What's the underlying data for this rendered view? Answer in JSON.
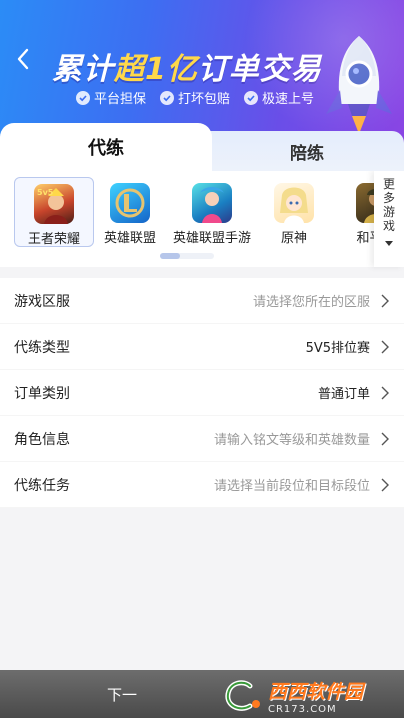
{
  "header": {
    "back_label": "back",
    "title_part1": "累计",
    "title_highlight": "超1亿",
    "title_part2": "订单交易",
    "features": [
      "平台担保",
      "打坏包赔",
      "极速上号"
    ]
  },
  "tabs": [
    {
      "label": "代练",
      "active": true
    },
    {
      "label": "陪练",
      "active": false
    }
  ],
  "games": [
    {
      "name": "王者荣耀",
      "selected": true,
      "icon": "honor-of-kings-icon"
    },
    {
      "name": "英雄联盟",
      "selected": false,
      "icon": "league-of-legends-icon"
    },
    {
      "name": "英雄联盟手游",
      "selected": false,
      "icon": "wild-rift-icon"
    },
    {
      "name": "原神",
      "selected": false,
      "icon": "genshin-icon"
    },
    {
      "name": "和平精",
      "selected": false,
      "icon": "peace-elite-icon"
    }
  ],
  "more_games": "更多游戏",
  "form": [
    {
      "label": "游戏区服",
      "value": "请选择您所在的区服",
      "filled": false
    },
    {
      "label": "代练类型",
      "value": "5V5排位赛",
      "filled": true
    },
    {
      "label": "订单类别",
      "value": "普通订单",
      "filled": true
    },
    {
      "label": "角色信息",
      "value": "请输入铭文等级和英雄数量",
      "filled": false
    },
    {
      "label": "代练任务",
      "value": "请选择当前段位和目标段位",
      "filled": false
    }
  ],
  "next_button": "下一",
  "watermark": {
    "main": "西西软件园",
    "sub": "CR173.COM"
  },
  "colors": {
    "accent": "#3d6ef2",
    "highlight": "#ffd84a",
    "button": "#555555"
  }
}
